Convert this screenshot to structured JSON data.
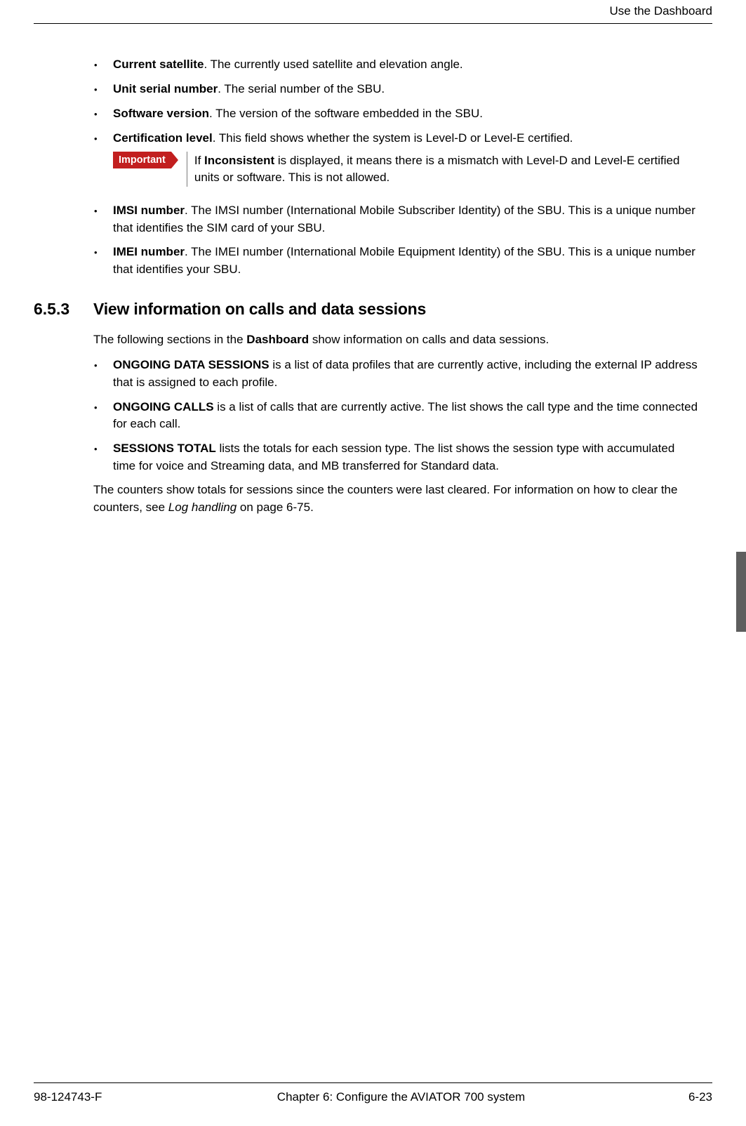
{
  "header": {
    "title": "Use the Dashboard"
  },
  "list1": [
    {
      "term": "Current satellite",
      "sep": ".",
      "desc": " The currently used satellite and elevation angle."
    },
    {
      "term": "Unit serial number",
      "sep": ".",
      "desc": " The serial number of the SBU."
    },
    {
      "term": "Software version",
      "sep": ".",
      "desc": " The version of the software embedded in the SBU."
    },
    {
      "term": "Certification level",
      "sep": ".",
      "desc": " This field shows whether the system is Level-D or Level-E certified."
    }
  ],
  "callout": {
    "tag": "Important",
    "pre": "If ",
    "bold": "Inconsistent",
    "post": " is displayed, it means there is a mismatch with Level-D and Level-E certified units or software. This is not allowed."
  },
  "list1b": [
    {
      "term": "IMSI number",
      "sep": ".",
      "desc": " The IMSI number (International Mobile Subscriber Identity) of the SBU. This is a unique number that identifies the SIM card of your SBU."
    },
    {
      "term": "IMEI number",
      "sep": ".",
      "desc": " The IMEI number (International Mobile Equipment Identity) of the SBU. This is a unique number that identifies your SBU."
    }
  ],
  "section": {
    "num": "6.5.3",
    "title": "View information on calls and data sessions"
  },
  "intro": {
    "pre": "The following sections in the ",
    "bold": "Dashboard",
    "post": " show information on calls and data sessions."
  },
  "list2": [
    {
      "term": "ONGOING DATA SESSIONS",
      "desc": " is a list of data profiles that are currently active, including the external IP address that is assigned to each profile."
    },
    {
      "term": "ONGOING CALLS",
      "desc": " is a list of calls that are currently active. The list shows the call type and the time connected for each call."
    },
    {
      "term": "SESSIONS TOTAL",
      "desc": " lists the totals for each session type. The list shows the session type with accumulated time for voice and Streaming data, and MB transferred for Standard data."
    }
  ],
  "closing": {
    "pre": "The counters show totals for sessions since the counters were last cleared. For information on how to clear the counters, see ",
    "ref": "Log handling",
    "post": " on page 6-75."
  },
  "footer": {
    "left": "98-124743-F",
    "center": "Chapter 6:  Configure the AVIATOR 700 system",
    "right": "6-23"
  },
  "bullet_glyph": "•"
}
